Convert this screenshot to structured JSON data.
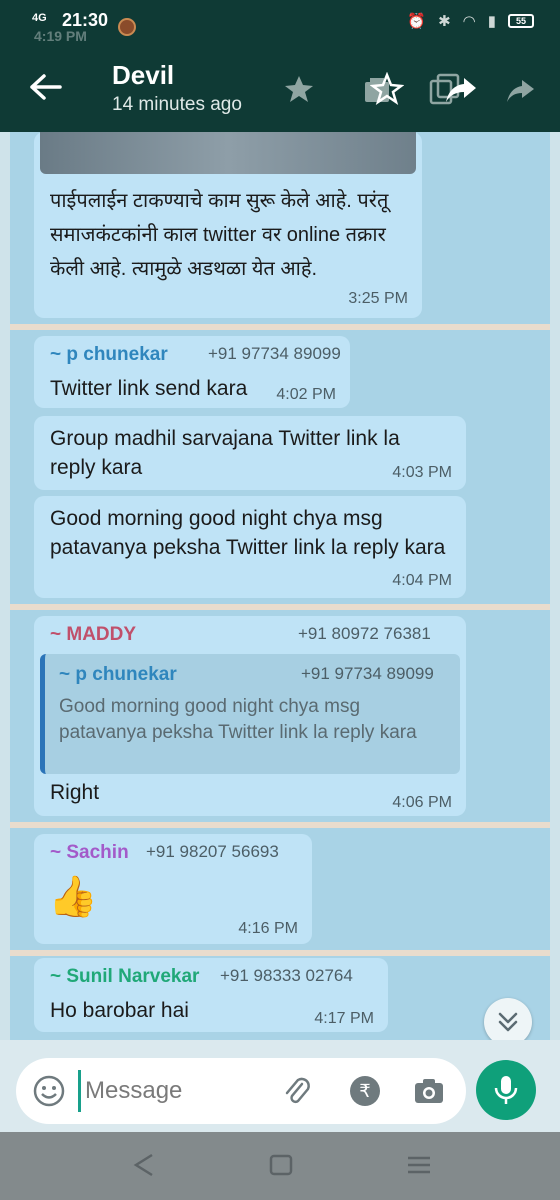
{
  "status_bar": {
    "network": "4G",
    "time": "21:30",
    "ghost_time": "4:19 PM",
    "battery": "55"
  },
  "header": {
    "contact_name": "Devil",
    "last_seen": "14 minutes ago",
    "icons": [
      "back-arrow-icon",
      "star-icon",
      "delete-icon",
      "copy-icon",
      "forward-icon",
      "more-icon"
    ]
  },
  "messages": [
    {
      "text": "पाईपलाईन टाकण्याचे काम सुरू केले आहे. परंतू समाजकंटकांनी काल twitter वर online तक्रार केली आहे. त्यामुळे अडथळा येत आहे.",
      "time": "3:25 PM"
    },
    {
      "sender": "~ p chunekar",
      "phone": "+91 97734 89099",
      "text": "Twitter link send kara",
      "time": "4:02 PM"
    },
    {
      "text": "Group madhil sarvajana Twitter link la reply kara",
      "time": "4:03 PM"
    },
    {
      "text": "Good morning good night chya msg patavanya peksha Twitter link la reply kara",
      "time": "4:04 PM"
    },
    {
      "sender": "~ MADDY",
      "phone": "+91 80972 76381",
      "quote": {
        "sender": "~ p chunekar",
        "phone": "+91 97734 89099",
        "text": "Good morning good night chya msg patavanya peksha Twitter link la reply kara"
      },
      "text": "Right",
      "time": "4:06 PM"
    },
    {
      "sender": "~ Sachin",
      "phone": "+91 98207 56693",
      "emoji": "👍",
      "time": "4:16 PM"
    },
    {
      "sender": "~ Sunil Narvekar",
      "phone": "+91 98333 02764",
      "text": "Ho barobar hai",
      "time": "4:17 PM"
    }
  ],
  "input": {
    "placeholder": "Message"
  },
  "colors": {
    "header": "#0f3a35",
    "chat_bg": "#a9d3e6",
    "bubble": "#bfe3f6",
    "sender_p_chunekar": "#2f86bd",
    "sender_maddy": "#c0506b",
    "sender_sachin": "#a35ac9",
    "sender_sunil": "#20a878",
    "mic": "#0fa07a"
  }
}
